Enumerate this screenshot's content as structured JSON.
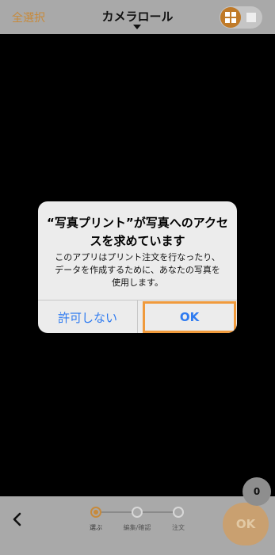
{
  "header": {
    "select_all": "全選択",
    "title": "カメラロール"
  },
  "dialog": {
    "title": "“写真プリント”が写真へのアクセスを求めています",
    "message": "このアプリはプリント注文を行なったり、データを作成するために、あなたの写真を使用します。",
    "deny_label": "許可しない",
    "ok_label": "OK"
  },
  "footer": {
    "steps": [
      {
        "label": "選ぶ",
        "active": true
      },
      {
        "label": "編集/確認",
        "active": false
      },
      {
        "label": "注文",
        "active": false
      }
    ],
    "ok_label": "OK",
    "count": "0"
  },
  "icons": {
    "back": "chevron-left-icon",
    "grid_view": "grid-icon",
    "single_view": "square-icon"
  },
  "colors": {
    "accent": "#c78a3b",
    "bar_bg": "#a9a9a9",
    "dialog_button": "#2f7bf0",
    "ok_highlight": "#f09a3c"
  }
}
